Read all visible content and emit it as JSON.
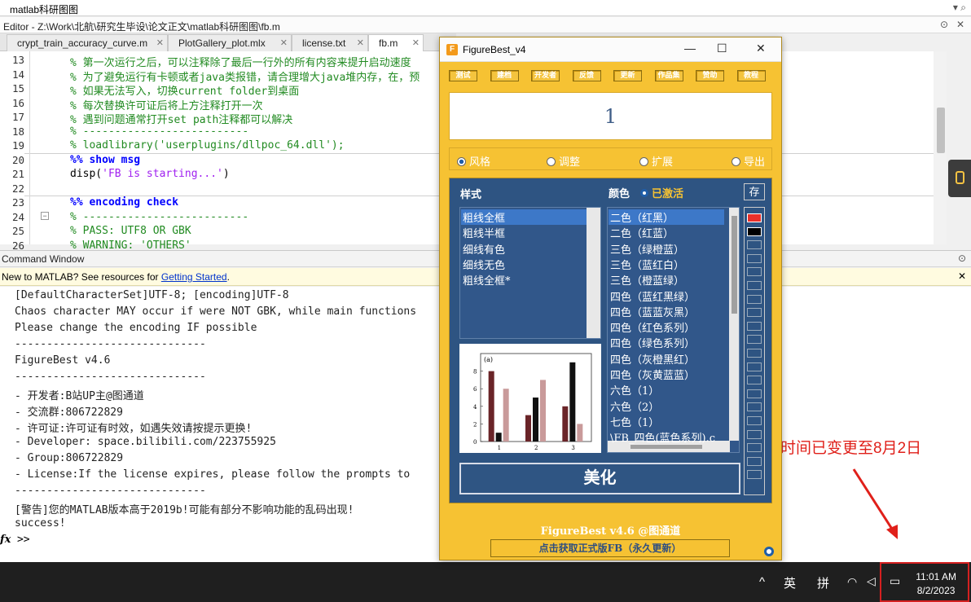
{
  "address": {
    "path": "matlab科研图图",
    "search_icon": "search-icon"
  },
  "editor_title": {
    "text": "Editor - Z:\\Work\\北航\\研究生毕设\\论文正文\\matlab科研图图\\fb.m"
  },
  "tabs": [
    {
      "label": "crypt_train_accuracy_curve.m",
      "active": false
    },
    {
      "label": "PlotGallery_plot.mlx",
      "active": false
    },
    {
      "label": "license.txt",
      "active": false
    },
    {
      "label": "fb.m",
      "active": true
    }
  ],
  "editor": {
    "lines": [
      {
        "n": "13",
        "text": "% 第一次运行之后，可以注释除了最后一行外的所有内容来提升启动速度",
        "kind": "cm"
      },
      {
        "n": "14",
        "text": "% 为了避免运行有卡顿或者java类报错，请合理增大java堆内存，在，预",
        "kind": "cm"
      },
      {
        "n": "15",
        "text": "% 如果无法写入，切换current folder到桌面",
        "kind": "cm"
      },
      {
        "n": "16",
        "text": "% 每次替换许可证后将上方注释打开一次",
        "kind": "cm"
      },
      {
        "n": "17",
        "text": "% 遇到问题通常打开set path注释都可以解决",
        "kind": "cm"
      },
      {
        "n": "18",
        "text": "% --------------------------",
        "kind": "cm"
      },
      {
        "n": "19",
        "text": "% loadlibrary('userplugins/dllpoc_64.dll');",
        "kind": "cm"
      },
      {
        "n": "20",
        "text": "%% show msg",
        "kind": "kw"
      },
      {
        "n": "21",
        "text": "disp(",
        "kind": "plain",
        "str": "'FB is starting...'",
        "tail": ")"
      },
      {
        "n": "22",
        "text": "",
        "kind": "plain"
      },
      {
        "n": "23",
        "text": "%% encoding check",
        "kind": "kw"
      },
      {
        "n": "24",
        "text": "% --------------------------",
        "kind": "cm"
      },
      {
        "n": "25",
        "text": "% PASS: UTF8 OR GBK",
        "kind": "cm"
      },
      {
        "n": "26",
        "text": "% WARNING: 'OTHERS'",
        "kind": "cm"
      }
    ]
  },
  "command_window": {
    "title": "Command Window",
    "notice_prefix": "New to MATLAB? See resources for ",
    "notice_link": "Getting Started",
    "notice_suffix": ".",
    "lines": [
      "[DefaultCharacterSet]UTF-8; [encoding]UTF-8",
      "Chaos character MAY occur if were NOT GBK, while main functions",
      "Please change the encoding IF possible",
      "------------------------------",
      "FigureBest v4.6",
      "------------------------------",
      "- 开发者:B站UP主@图通道",
      "- 交流群:806722829",
      "- 许可证:许可证有时效，如遇失效请按提示更换!",
      "- Developer: space.bilibili.com/223755925",
      "- Group:806722829",
      "- License:If the license expires, please follow the prompts to",
      "------------------------------",
      "[警告]您的MATLAB版本高于2019b!可能有部分不影响功能的乱码出现!",
      "success!"
    ],
    "prompt_fx": "fx",
    "prompt": ">>"
  },
  "annotation": {
    "text": "时间已变更至8月2日",
    "color": "#e0201a"
  },
  "figurebest": {
    "title": "FigureBest_v4",
    "toolbar": [
      "测试",
      "建档",
      "开发者",
      "反馈",
      "更新",
      "作品集",
      "赞助",
      "教程"
    ],
    "number": "1",
    "radios": [
      {
        "label": "风格",
        "on": true
      },
      {
        "label": "调整",
        "on": false
      },
      {
        "label": "扩展",
        "on": false
      },
      {
        "label": "导出",
        "on": false
      }
    ],
    "style_label": "样式",
    "color_label": "颜色",
    "activated_label": "已激活",
    "save_label": "存",
    "styles": [
      "粗线全框",
      "粗线半框",
      "细线有色",
      "细线无色",
      "粗线全框*"
    ],
    "colors": [
      "二色（红黑）",
      "二色（红蓝）",
      "三色（绿橙蓝）",
      "三色（蓝红白）",
      "三色（橙蓝绿）",
      "四色（蓝红黑绿）",
      "四色（蓝蓝灰黑）",
      "四色（红色系列）",
      "四色（绿色系列）",
      "四色（灰橙黑红）",
      "四色（灰黄蓝蓝）",
      "六色（1）",
      "六色（2）",
      "七色（1）",
      "\\FB_四色(蓝色系列).c"
    ],
    "swatch_colors": [
      "#e8302a",
      "#000000"
    ],
    "preview_chart": {
      "panel_label": "(a)",
      "yticks": [
        "8",
        "6",
        "4",
        "2",
        "0"
      ],
      "xticks": [
        "1",
        "2",
        "3"
      ],
      "ylim": [
        0,
        10
      ],
      "series": [
        {
          "values": [
            8,
            3,
            4
          ],
          "color": "#6a2428"
        },
        {
          "values": [
            1,
            5,
            9
          ],
          "color": "#111111"
        },
        {
          "values": [
            6,
            7,
            2
          ],
          "color": "#c99a9a"
        }
      ]
    },
    "beautify_label": "美化",
    "footer": "FigureBest v4.6 @图通道",
    "link": "点击获取正式版FB（永久更新）"
  },
  "taskbar": {
    "ime1": "英",
    "ime2": "拼",
    "time": "11:01 AM",
    "date": "8/2/2023"
  }
}
